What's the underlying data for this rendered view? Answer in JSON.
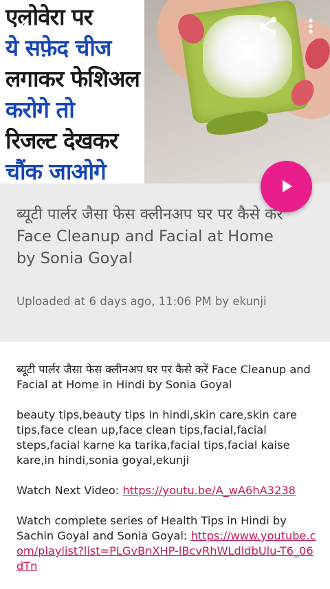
{
  "hero": {
    "lines": [
      {
        "text": "एलोवेरा पर",
        "color": "black"
      },
      {
        "text": "ये सफ़ेद चीज",
        "color": "blue"
      },
      {
        "text": "लगाकर फेशिअल",
        "color": "black"
      },
      {
        "text": "करोगे तो",
        "color": "blue"
      },
      {
        "text": "रिजल्ट देखकर",
        "color": "black"
      },
      {
        "text": "चौंक जाओगे",
        "color": "blue"
      }
    ]
  },
  "toolbar": {
    "back_icon": "arrow-back-icon",
    "share_icon": "share-icon",
    "more_icon": "more-vert-icon"
  },
  "video": {
    "title": "ब्यूटी पार्लर जैसा फेस क्लीनअप घर पर कैसे करें Face Cleanup and Facial at Home by Sonia Goyal",
    "uploaded": "Uploaded at 6 days ago, 11:06 PM by ekunji",
    "play_icon": "play-icon"
  },
  "description": {
    "intro": "ब्यूटी पार्लर जैसा फेस क्लीनअप घर पर कैसे करें Face Cleanup and Facial at Home in Hindi by Sonia Goyal",
    "tags": "beauty tips,beauty tips in hindi,skin care,skin care tips,face clean up,face clean tips,facial,facial steps,facial karne ka tarika,facial tips,facial kaise kare,in hindi,sonia goyal,ekunji",
    "next_label": "Watch Next Video: ",
    "next_link": "https://youtu.be/A_wA6hA3238",
    "series_label": "Watch complete series of Health Tips in Hindi by Sachin Goyal and Sonia Goyal: ",
    "series_link": "https://www.youtube.com/playlist?list=PLGvBnXHP-lBcvRhWLdldbUlu-T6_06dTn"
  },
  "colors": {
    "accent": "#e91e8c",
    "hero_blue": "#1747b8",
    "link": "#c2185b",
    "panel_bg": "#ebebeb"
  }
}
